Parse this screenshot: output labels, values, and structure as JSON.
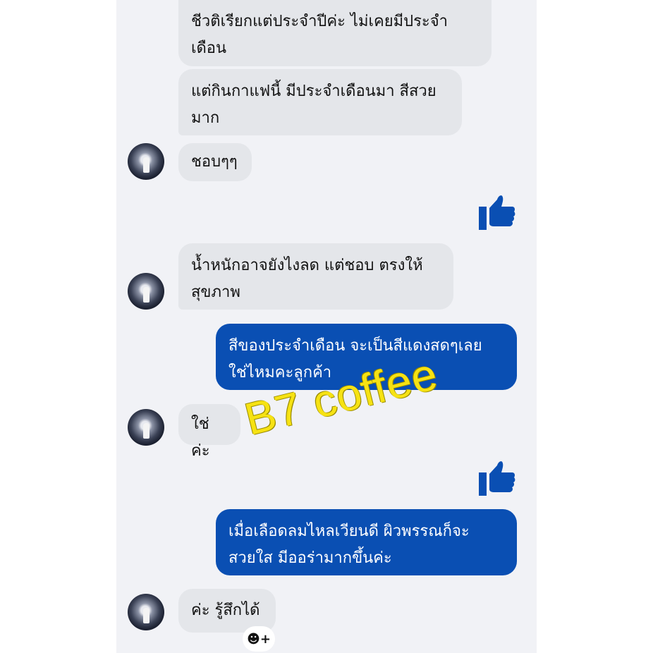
{
  "messages": [
    {
      "side": "in",
      "text": "ชีวติเรียกแต่ประจำปีค่ะ ไม่เคยมีประจำ\nเดือน"
    },
    {
      "side": "in",
      "text": "แต่กินกาแฟนี้ มีประจำเดือนมา สีสวย\nมาก"
    },
    {
      "side": "in",
      "text": "ชอบๆๆ"
    },
    {
      "side": "out",
      "type": "like",
      "icon": "thumbs-up-icon"
    },
    {
      "side": "in",
      "text": "น้ำหนักอาจยังไงลด แต่ชอบ ตรงให้\nสุขภาพ"
    },
    {
      "side": "out",
      "text": "สีของประจำเดือน จะเป็นสีแดงสดๆเลย\nใช่ไหมคะลูกค้า"
    },
    {
      "side": "in",
      "text": "ใช่ค่ะ"
    },
    {
      "side": "out",
      "type": "like",
      "icon": "thumbs-up-icon"
    },
    {
      "side": "out",
      "text": "เมื่อเลือดลมไหลเวียนดี  ผิวพรรณก็จะ\nสวยใส  มีออร่ามากขึ้นค่ะ"
    },
    {
      "side": "in",
      "text": "ค่ะ รู้สึกได้"
    }
  ],
  "watermark": "B7 coffee",
  "reaction_button": {
    "icon": "add-reaction-icon",
    "label": "☻+"
  },
  "colors": {
    "incoming_bubble": "#e4e6ea",
    "outgoing_bubble": "#0a4fb3",
    "like_icon": "#0a4fb3",
    "chat_background": "#f1f2f6",
    "watermark": "#f6e213"
  }
}
